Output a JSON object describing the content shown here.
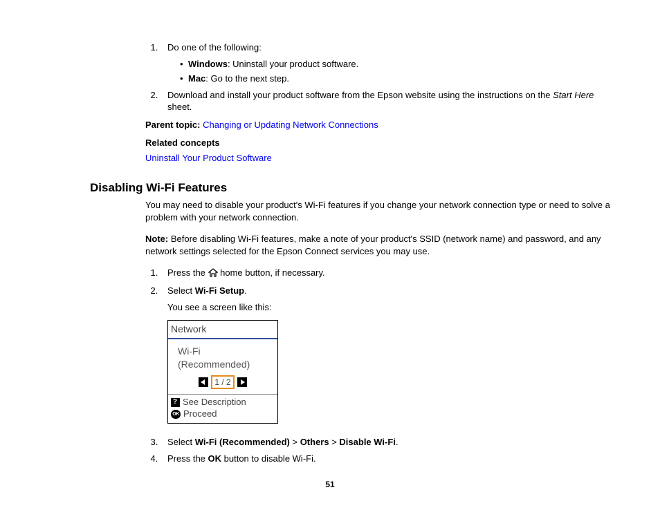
{
  "section1": {
    "step1_intro": "Do one of the following:",
    "bullet_windows_bold": "Windows",
    "bullet_windows_text": ": Uninstall your product software.",
    "bullet_mac_bold": "Mac",
    "bullet_mac_text": ": Go to the next step.",
    "step2_a": "Download and install your product software from the Epson website using the instructions on the ",
    "step2_italic": "Start Here",
    "step2_b": " sheet.",
    "parent_topic_label": "Parent topic: ",
    "parent_topic_link": "Changing or Updating Network Connections",
    "related_concepts_label": "Related concepts",
    "related_concepts_link": "Uninstall Your Product Software"
  },
  "section2": {
    "heading": "Disabling Wi-Fi Features",
    "intro": "You may need to disable your product's Wi-Fi features if you change your network connection type or need to solve a problem with your network connection.",
    "note_bold": "Note:",
    "note_text": " Before disabling Wi-Fi features, make a note of your product's SSID (network name) and password, and any network settings selected for the Epson Connect services you may use.",
    "step1_a": "Press the ",
    "step1_b": " home button, if necessary.",
    "step2_a": "Select ",
    "step2_bold": "Wi-Fi Setup",
    "step2_b": ".",
    "step2_followup": "You see a screen like this:",
    "step3_a": "Select ",
    "step3_b1": "Wi-Fi (Recommended)",
    "step3_gt1": " > ",
    "step3_b2": "Others",
    "step3_gt2": " > ",
    "step3_b3": "Disable Wi-Fi",
    "step3_end": ".",
    "step4_a": "Press the ",
    "step4_bold": "OK",
    "step4_b": " button to disable Wi-Fi."
  },
  "lcd": {
    "header": "Network",
    "option_line1": "Wi-Fi",
    "option_line2": "(Recommended)",
    "page_indicator": "1 / 2",
    "footer_see": "See Description",
    "footer_proceed": "Proceed"
  },
  "page_number": "51"
}
